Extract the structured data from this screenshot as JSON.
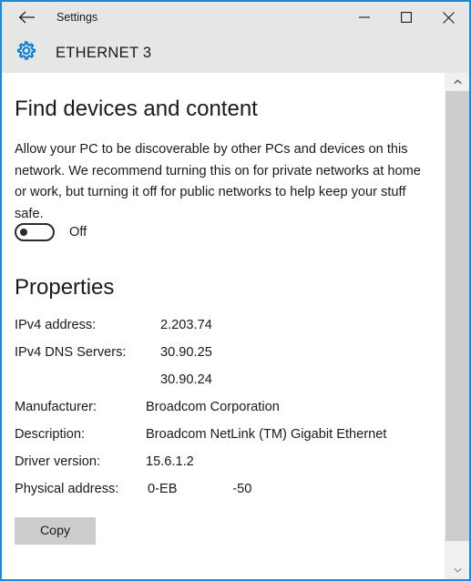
{
  "window": {
    "border_color": "#1d8ad8",
    "titlebar_bg": "#e6e6e6",
    "title": "Settings",
    "back_icon": "back-arrow-icon",
    "controls": {
      "minimize": "minimize-icon",
      "maximize": "maximize-icon",
      "close": "close-icon"
    }
  },
  "header": {
    "icon": "gear-icon",
    "icon_color": "#0b7ed4",
    "title": "ETHERNET 3"
  },
  "main": {
    "heading": "Find devices and content",
    "description": "Allow your PC to be discoverable by other PCs and devices on this network. We recommend turning this on for private networks at home or work, but turning it off for public networks to help keep your stuff safe.",
    "toggle": {
      "state": "off",
      "label": "Off"
    },
    "properties_heading": "Properties",
    "properties": [
      {
        "label": "IPv4 address:",
        "value": "2.203.74"
      },
      {
        "label": "IPv4 DNS Servers:",
        "value": "30.90.25"
      },
      {
        "label": "",
        "value": "30.90.24"
      },
      {
        "label": "Manufacturer:",
        "value": "Broadcom Corporation"
      },
      {
        "label": "Description:",
        "value": "Broadcom NetLink (TM) Gigabit Ethernet"
      },
      {
        "label": "Driver version:",
        "value": "15.6.1.2"
      },
      {
        "label": "Physical address:",
        "value": "0-EB               -50"
      }
    ],
    "copy_button": "Copy"
  },
  "scrollbar": {
    "up_icon": "chevron-up-icon",
    "down_icon": "chevron-down-icon",
    "track_color": "#f0f0f0",
    "thumb_color": "#cdcdcd"
  }
}
